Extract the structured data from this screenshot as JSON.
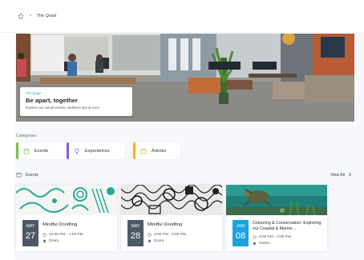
{
  "breadcrumb": {
    "home_icon": "home-icon",
    "separator": ">",
    "current": "The Quad"
  },
  "hero": {
    "eyebrow": "The Quad",
    "title": "Be apart, together",
    "subtitle": "Explore our virtual events, wellness tips & more"
  },
  "categories": {
    "label": "Categories",
    "items": [
      {
        "label": "Events",
        "icon": "calendar-icon",
        "color": "#7ac143"
      },
      {
        "label": "Experiences",
        "icon": "lightbulb-icon",
        "color": "#8e5cd9"
      },
      {
        "label": "Articles",
        "icon": "calendar-icon",
        "color": "#f2b31b"
      }
    ]
  },
  "events": {
    "label": "Events",
    "view_all": "View All",
    "view_all_icon": "chevron-right-icon",
    "items": [
      {
        "month": "MAY",
        "day": "27",
        "title": "Mindful Doodling",
        "time": "12:00 PM - 1:00 PM",
        "location": "Zoom",
        "date_color": "#4d5966"
      },
      {
        "month": "MAY",
        "day": "28",
        "title": "Mindful Doodling",
        "time": "3:00 PM - 4:00 PM",
        "location": "Zoom",
        "date_color": "#4d5966"
      },
      {
        "month": "JUN",
        "day": "08",
        "title": "Colouring & Conservation: Exploring our Coastal & Marine...",
        "time": "3:00 PM - 4:00 PM",
        "location": "Online",
        "date_color": "#1aa3df"
      }
    ]
  }
}
